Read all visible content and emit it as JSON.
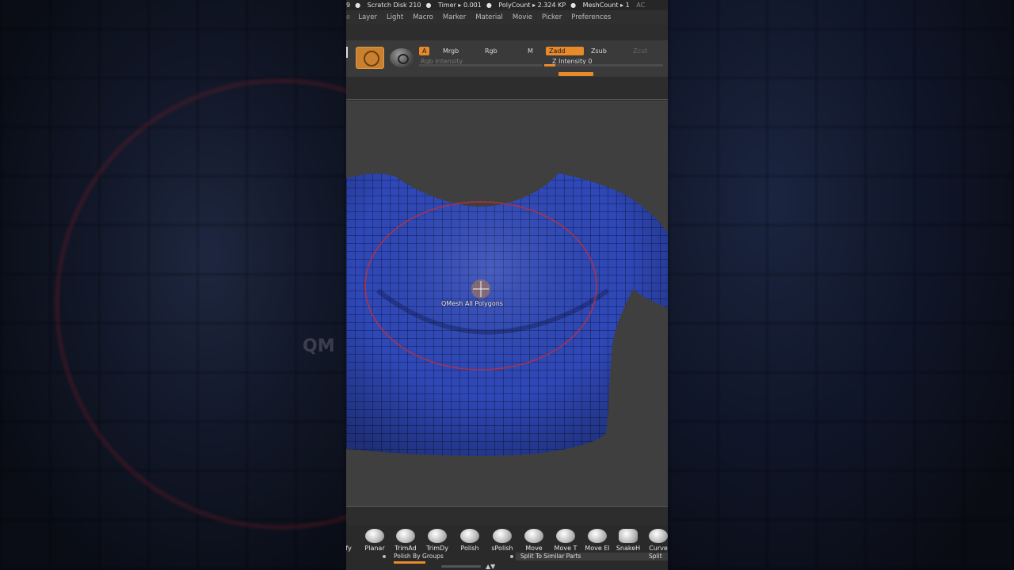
{
  "status_bar": {
    "prefix": "9",
    "scratch_disk": "Scratch Disk 210",
    "timer": "Timer ▸ 0.001",
    "polycount": "PolyCount ▸ 2.324 KP",
    "meshcount": "MeshCount ▸ 1",
    "suffix": "AC"
  },
  "menu": [
    "Layer",
    "Light",
    "Macro",
    "Marker",
    "Material",
    "Movie",
    "Picker",
    "Preferences"
  ],
  "toolbar": {
    "a": "A",
    "mrgb": "Mrgb",
    "rgb": "Rgb",
    "m": "M",
    "zadd": "Zadd",
    "zsub": "Zsub",
    "zcut": "Zcut",
    "rgb_intensity": "Rgb Intensity",
    "z_intensity": "Z Intensity 0",
    "z_intensity_value": 0
  },
  "viewport": {
    "cursor_label": "QMesh All Polygons",
    "mesh_color": "#2f48b8",
    "brush_ring_color": "#c0303a"
  },
  "background": {
    "ghost_text": "QM"
  },
  "shelf": {
    "tools": [
      {
        "label": "ify"
      },
      {
        "label": "Planar"
      },
      {
        "label": "TrimAd"
      },
      {
        "label": "TrimDy"
      },
      {
        "label": "Polish"
      },
      {
        "label": "sPolish"
      },
      {
        "label": "Move"
      },
      {
        "label": "Move T"
      },
      {
        "label": "Move El"
      },
      {
        "label": "SnakeH"
      },
      {
        "label": "Curve"
      }
    ],
    "polish_by_groups": "Polish By Groups",
    "split_similar": "Split To Similar Parts",
    "split": "Split"
  },
  "colors": {
    "accent": "#e8892a",
    "panel": "#2d2d2d"
  }
}
